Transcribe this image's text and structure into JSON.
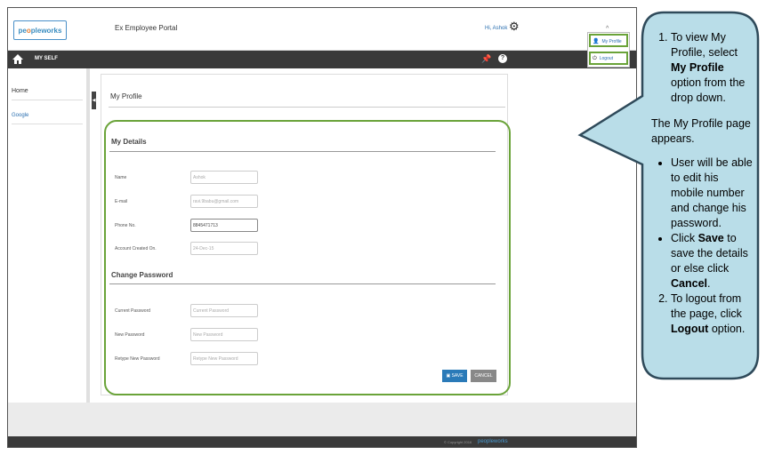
{
  "header": {
    "logo_prefix": "pe",
    "logo_o": "o",
    "logo_suffix": "pleworks",
    "portal_title": "Ex Employee Portal",
    "greeting": "Hi, Ashok"
  },
  "navbar": {
    "section": "MY SELF"
  },
  "sidebar": {
    "items": [
      {
        "label": "Home"
      },
      {
        "label": "Google"
      }
    ]
  },
  "main": {
    "title": "My Profile"
  },
  "details": {
    "heading": "My Details",
    "fields": [
      {
        "label": "Name",
        "value": "Ashok"
      },
      {
        "label": "E-mail",
        "value": "ravi.9babu@gmail.com"
      },
      {
        "label": "Phone No.",
        "value": "8845471713"
      },
      {
        "label": "Account Created On.",
        "value": "24-Dec-15"
      }
    ]
  },
  "password": {
    "heading": "Change Password",
    "fields": [
      {
        "label": "Current Password",
        "placeholder": "Current Password"
      },
      {
        "label": "New Password",
        "placeholder": "New Password"
      },
      {
        "label": "Retype New Password",
        "placeholder": "Retype New Password"
      }
    ]
  },
  "actions": {
    "save": "SAVE",
    "cancel": "CANCEL"
  },
  "dropdown": {
    "my_profile": "My Profile",
    "logout": "Logout"
  },
  "footer": {
    "copyright": "© Copyright 2016",
    "brand": "peopleworks"
  },
  "callout": {
    "step1_a": "To view My Profile, select ",
    "step1_b": "My Profile",
    "step1_c": " option from the drop down.",
    "para": "The My Profile page appears.",
    "bullet1": "User will be able to edit his mobile number and change his password.",
    "bullet2_a": "Click ",
    "bullet2_b": "Save",
    "bullet2_c": " to save the details or else click ",
    "bullet2_d": "Cancel",
    "bullet2_e": ".",
    "step2_a": "To logout from the page, click ",
    "step2_b": "Logout",
    "step2_c": " option."
  },
  "colors": {
    "accent": "#6aa339",
    "brand": "#2a7ab8",
    "navbar": "#3a3a3a",
    "callout_fill": "#b9dde8",
    "callout_stroke": "#2f4a5a"
  },
  "icons": [
    "home-icon",
    "gear-icon",
    "pin-icon",
    "help-icon",
    "user-icon",
    "power-icon",
    "save-icon",
    "collapse-arrow-icon"
  ]
}
